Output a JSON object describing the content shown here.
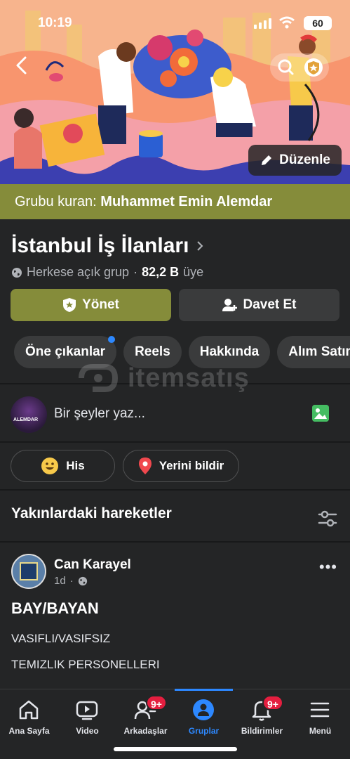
{
  "status_bar": {
    "time": "10:19",
    "battery": "60"
  },
  "cover": {
    "edit_label": "Düzenle"
  },
  "creator": {
    "prefix": "Grubu kuran:",
    "name": "Muhammet Emin Alemdar"
  },
  "group": {
    "name": "İstanbul İş İlanları",
    "privacy": "Herkese açık grup",
    "separator": "·",
    "members": "82,2 B",
    "members_suffix": "üye"
  },
  "buttons": {
    "manage": "Yönet",
    "invite": "Davet Et"
  },
  "chips": [
    "Öne çıkanlar",
    "Reels",
    "Hakkında",
    "Alım Satım"
  ],
  "watermark": {
    "text": "itemsatış"
  },
  "composer": {
    "avatar_text": "ALEMDAR",
    "placeholder": "Bir şeyler yaz..."
  },
  "actions": {
    "feeling": "His",
    "checkin": "Yerini bildir"
  },
  "section": {
    "title": "Yakınlardaki hareketler"
  },
  "post": {
    "author": "Can Karayel",
    "time": "1d",
    "separator": "·",
    "more": "•••",
    "title": "BAY/BAYAN",
    "line1": "VASIFLI/VASIFSIZ",
    "line2": "TEMIZLIK PERSONELLERI"
  },
  "tabbar": {
    "items": [
      {
        "label": "Ana Sayfa",
        "icon": "home-icon"
      },
      {
        "label": "Video",
        "icon": "video-icon"
      },
      {
        "label": "Arkadaşlar",
        "icon": "friends-icon",
        "badge": "9+"
      },
      {
        "label": "Gruplar",
        "icon": "groups-icon",
        "active": true
      },
      {
        "label": "Bildirimler",
        "icon": "bell-icon",
        "badge": "9+"
      },
      {
        "label": "Menü",
        "icon": "menu-icon"
      }
    ]
  },
  "colors": {
    "accent": "#858c3a",
    "active_tab": "#2d88ff",
    "badge": "#e41e3f",
    "background": "#242526"
  }
}
